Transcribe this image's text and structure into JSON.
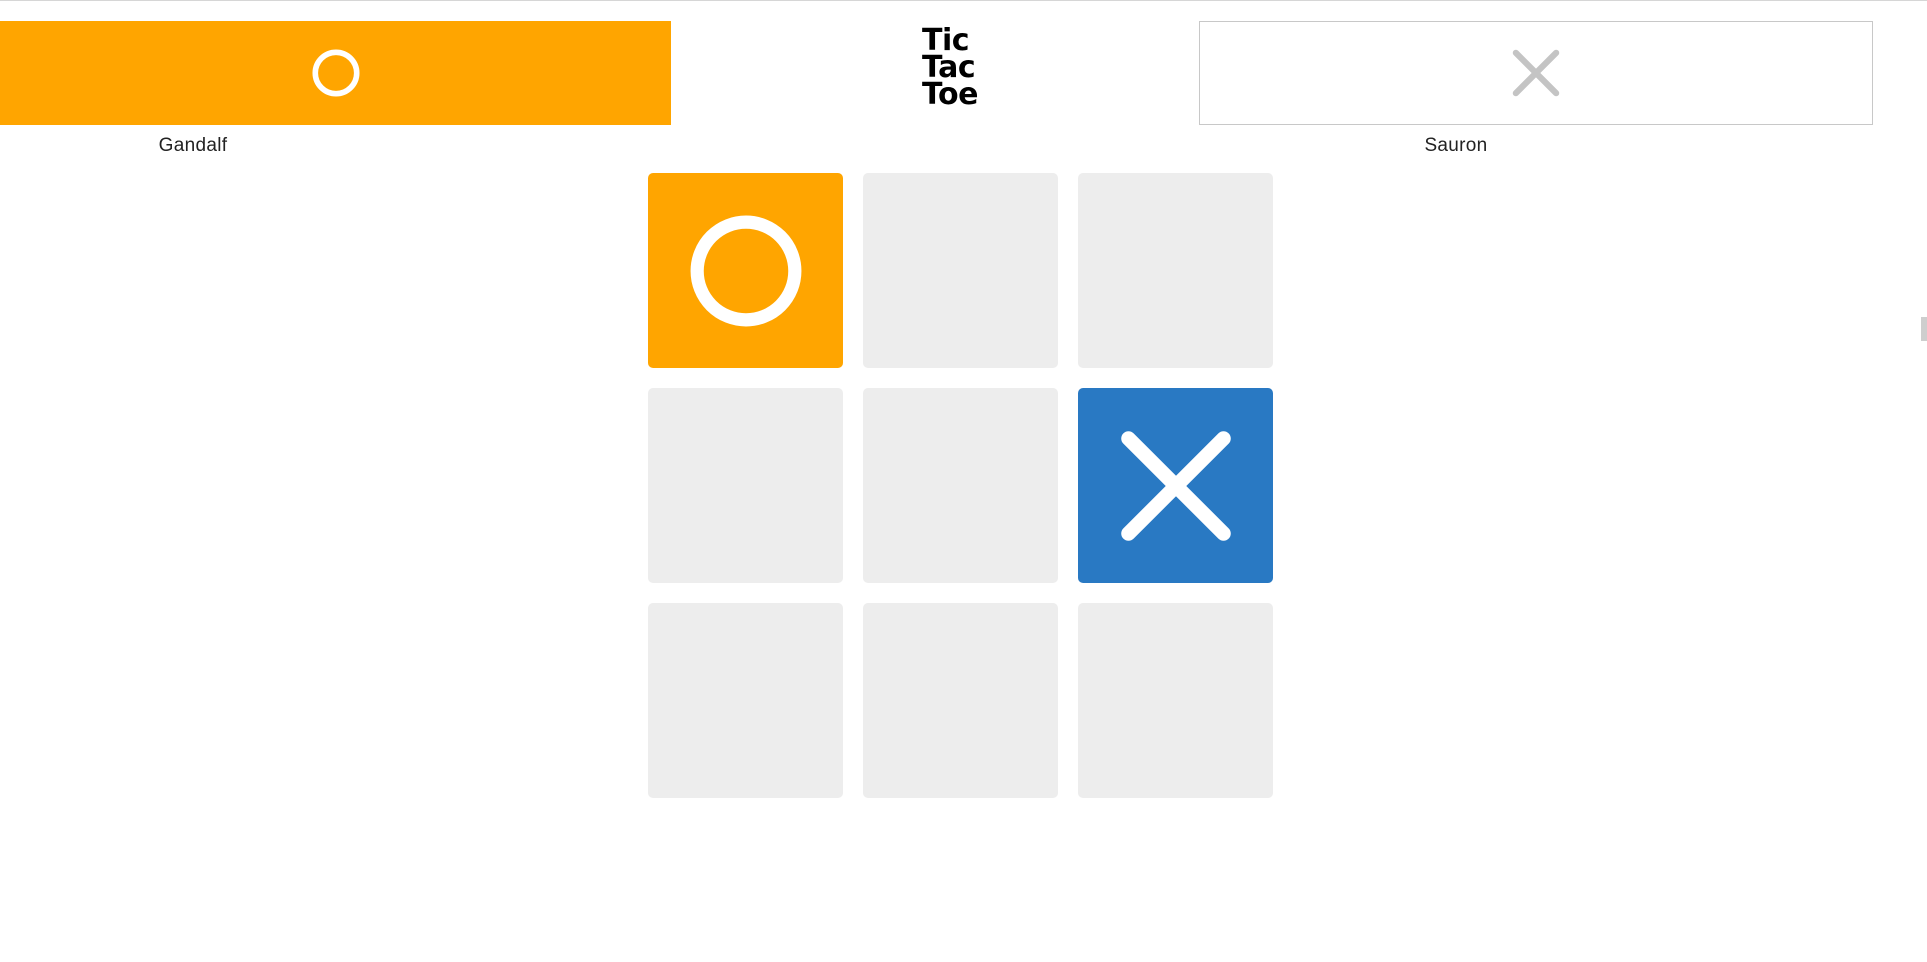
{
  "app": {
    "logo_lines": [
      "Tic",
      "Tac",
      "Toe"
    ]
  },
  "colors": {
    "o_accent": "#FFA500",
    "x_accent": "#2979C3",
    "empty_cell": "#EDEDED",
    "inactive_mark": "#C4C4C4",
    "mark_on_fill": "#FFFFFF"
  },
  "players": {
    "o": {
      "name": "Gandalf",
      "symbol": "O",
      "icon": "circle-icon",
      "active": true
    },
    "x": {
      "name": "Sauron",
      "symbol": "X",
      "icon": "cross-icon",
      "active": false
    }
  },
  "board": {
    "cells": [
      "O",
      "",
      "",
      "",
      "",
      "X",
      "",
      "",
      ""
    ]
  }
}
